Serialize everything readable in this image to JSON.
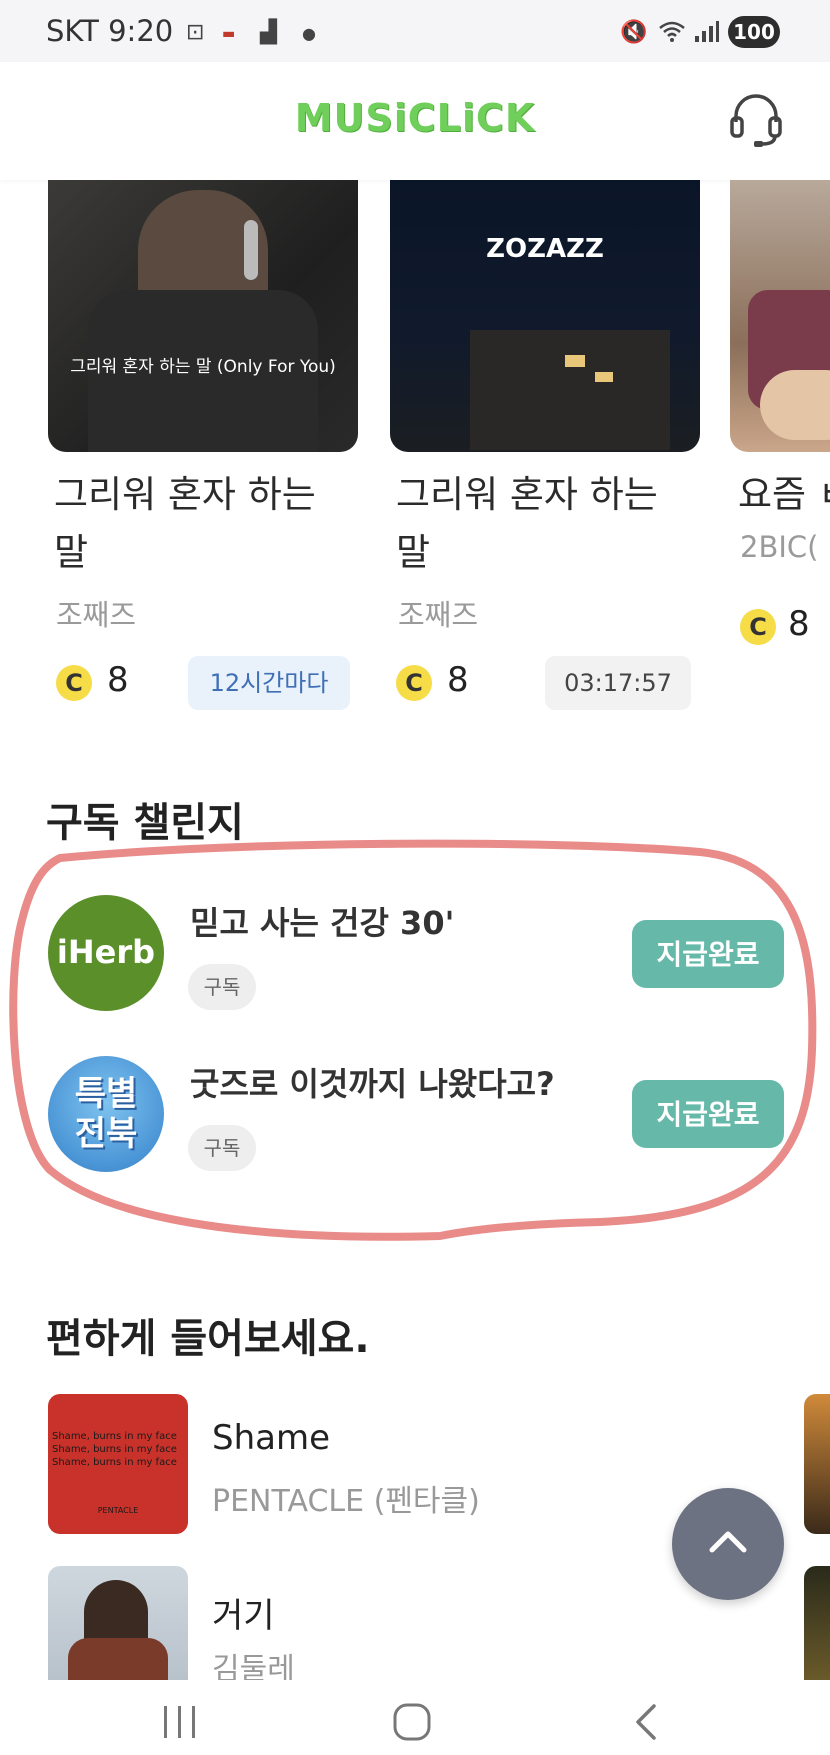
{
  "status_bar": {
    "carrier_time": "SKT 9:20",
    "battery": "100"
  },
  "app": {
    "logo": "MUSiCLiCK"
  },
  "cards": [
    {
      "thumb_caption": "그리워 혼자 하는 말 (Only For You)",
      "title_line1": "그리워 혼자 하는",
      "title_line2": "말",
      "artist": "조째즈",
      "coin_icon": "C",
      "coins": "8",
      "chip": "12시간마다"
    },
    {
      "thumb_caption": "ZOZAZZ",
      "title_line1": "그리워 혼자 하는",
      "title_line2": "말",
      "artist": "조째즈",
      "coin_icon": "C",
      "coins": "8",
      "chip": "03:17:57"
    },
    {
      "title_line1": "요즘 ㅂ",
      "artist": "2BIC(",
      "coin_icon": "C",
      "coins": "8"
    }
  ],
  "challenge": {
    "section_title": "구독 챌린지",
    "items": [
      {
        "logo_text": "iHerb",
        "title": "믿고 사는 건강 30'",
        "tag": "구독",
        "button": "지급완료"
      },
      {
        "logo_text_1": "특별",
        "logo_text_2": "전북",
        "title": "굿즈로 이것까지 나왔다고?",
        "tag": "구독",
        "button": "지급완료"
      }
    ],
    "highlight_color": "#e57b7b"
  },
  "easy_listening": {
    "section_title": "편하게 들어보세요.",
    "items": [
      {
        "art_line1": "Shame, burns in my face",
        "art_line2": "Shame, burns in my face",
        "art_line3": "Shame, burns in my face",
        "art_label": "PENTACLE",
        "title": "Shame",
        "artist": "PENTACLE (펜타클)"
      },
      {
        "title": "거기",
        "artist": "김둘레"
      }
    ]
  },
  "colors": {
    "brand": "#6fcf5a",
    "paid_button": "#66b9a8",
    "coin": "#f6dc47"
  }
}
